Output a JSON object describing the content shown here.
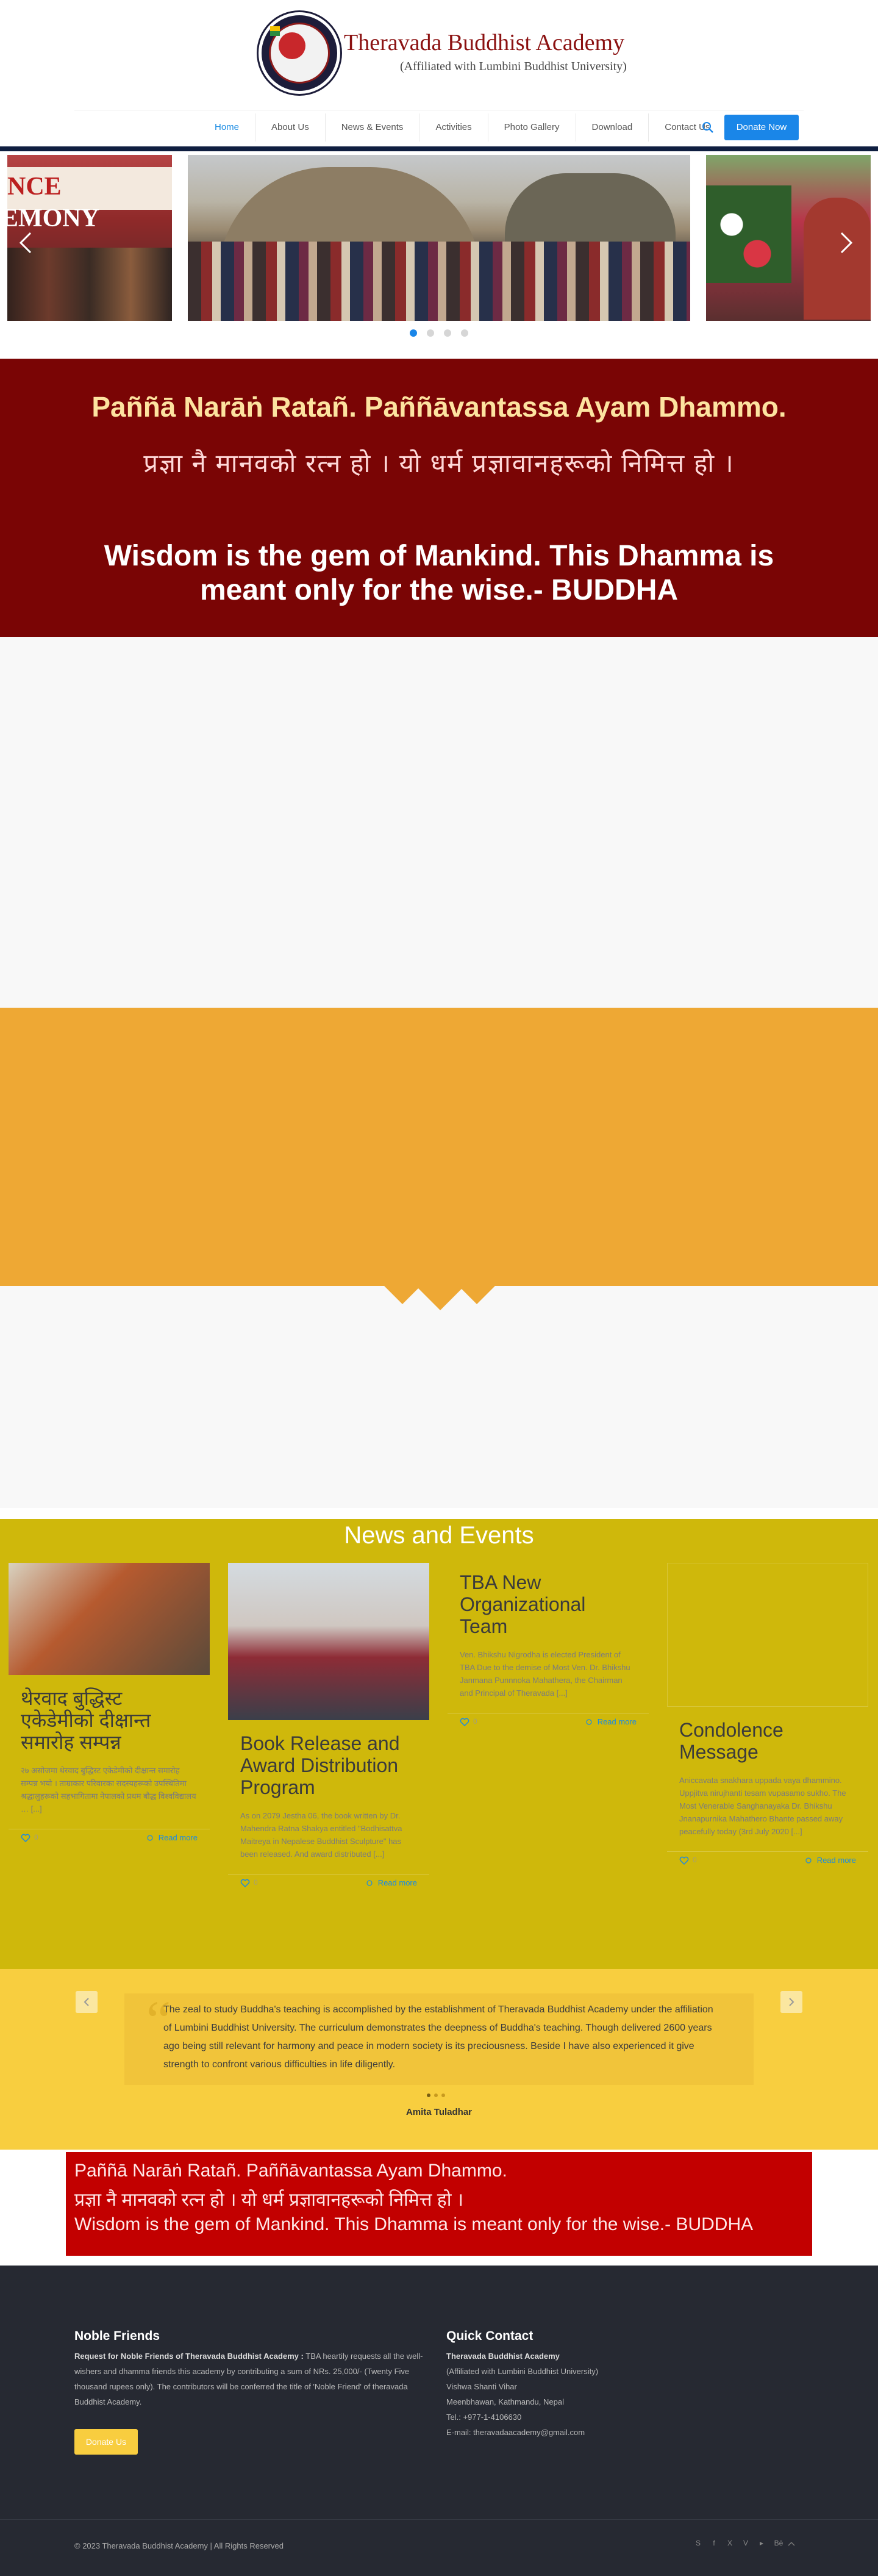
{
  "header": {
    "logo_title": "Theravada Buddhist Academy",
    "logo_subtitle": "(Affiliated with Lumbini Buddhist University)",
    "nav": [
      "Home",
      "About Us",
      "News & Events",
      "Activities",
      "Photo Gallery",
      "Download",
      "Contact Us"
    ],
    "active_nav": "Home",
    "donate_label": "Donate Now",
    "accent_color": "#1a86e8"
  },
  "slider": {
    "left_banner_text": "NCE",
    "left_banner_text2": "EMONY",
    "dots": 4,
    "active_dot": 1
  },
  "quote": {
    "pali": "Paññā Narāṅ Ratañ. Paññāvantassa Ayam Dhammo.",
    "nepali": "प्रज्ञा नै मानवको रत्न हो । यो धर्म प्रज्ञावानहरूको निमित्त हो ।",
    "english": "Wisdom is the gem of Mankind. This Dhamma is meant only for the wise.- BUDDHA",
    "background": "#7a0505"
  },
  "news": {
    "section_title": "News and Events",
    "cards": [
      {
        "title": "थेरवाद बुद्धिस्ट एकेडेमीको दीक्षान्त समारोह सम्पन्न",
        "text": "२७ असोजमा थेरवाद बुद्धिस्ट एकेडेमीको दीक्षान्त समारोह सम्पन्न भयो । ताम्राकार परिवारका सदस्यहरूको उपस्थितिमा श्रद्धालुहरूको सहभागितामा नेपालको प्रथम बौद्ध विश्वविद्यालय … [...]",
        "likes": "0",
        "readmore": "Read more"
      },
      {
        "title": "Book Release and Award Distribution Program",
        "text": "As on 2079 Jestha 06, the book written by Dr. Mahendra Ratna Shakya entitled \"Bodhisattva Maitreya in Nepalese Buddhist Sculpture\" has been released. And award distributed [...]",
        "likes": "0",
        "readmore": "Read more"
      },
      {
        "title": "TBA New Organizational Team",
        "text": "Ven. Bhikshu Nigrodha is elected President of TBA Due to the demise of Most Ven. Dr. Bhikshu Janmana Punnnoka Mahathera, the Chairman and Principal of Theravada [...]",
        "likes": "0",
        "readmore": "Read more"
      },
      {
        "title": "Condolence Message",
        "text": "Aniccavata snakhara uppada vaya dhammino. Uppjitva nirujhanti tesam vupasamo sukho. The Most Venerable Sanghanayaka Dr. Bhikshu Jnanapurnika Mahathero Bhante passed away peacefully today (3rd July 2020 [...]",
        "likes": "0",
        "readmore": "Read more"
      }
    ]
  },
  "testimonial": {
    "text": "The zeal to study Buddha's teaching is accomplished by the establishment of Theravada Buddhist Academy under the affiliation of Lumbini Buddhist University. The curriculum demonstrates the deepness of Buddha's teaching. Though delivered 2600 years ago being still relevant for harmony and peace in modern society is its preciousness. Beside I have also experienced it give strength to confront various difficulties in life diligently.",
    "author": "Amita Tuladhar"
  },
  "red_quote": {
    "line1": "Paññā Narāṅ Ratañ. Paññāvantassa Ayam Dhammo.",
    "line2": "प्रज्ञा नै मानवको रत्न हो । यो धर्म प्रज्ञावानहरूको निमित्त हो ।",
    "line3": "Wisdom is the gem of Mankind. This Dhamma is meant only for the wise.- BUDDHA"
  },
  "footer": {
    "noble_heading": "Noble Friends",
    "noble_text_bold": "Request for Noble Friends of Theravada Buddhist Academy :",
    "noble_text": "TBA heartily requests all the well-wishers and dhamma friends this academy by contributing a sum of NRs. 25,000/- (Twenty Five thousand rupees only). The contributors will be conferred the title of 'Noble Friend' of theravada Buddhist Academy.",
    "donate_label": "Donate Us",
    "contact_heading": "Quick Contact",
    "contact_lines": [
      "Theravada Buddhist Academy",
      "(Affiliated with Lumbini Buddhist University)",
      "Vishwa Shanti Vihar",
      "Meenbhawan, Kathmandu, Nepal",
      "Tel.: +977-1-4106630",
      "E-mail: theravadaacademy@gmail.com"
    ],
    "copyright": "© 2023 Theravada Buddhist Academy | All Rights Reserved",
    "social_icons": [
      "skype-icon",
      "facebook-icon",
      "x-icon",
      "vimeo-icon",
      "youtube-icon",
      "behance-icon"
    ]
  }
}
